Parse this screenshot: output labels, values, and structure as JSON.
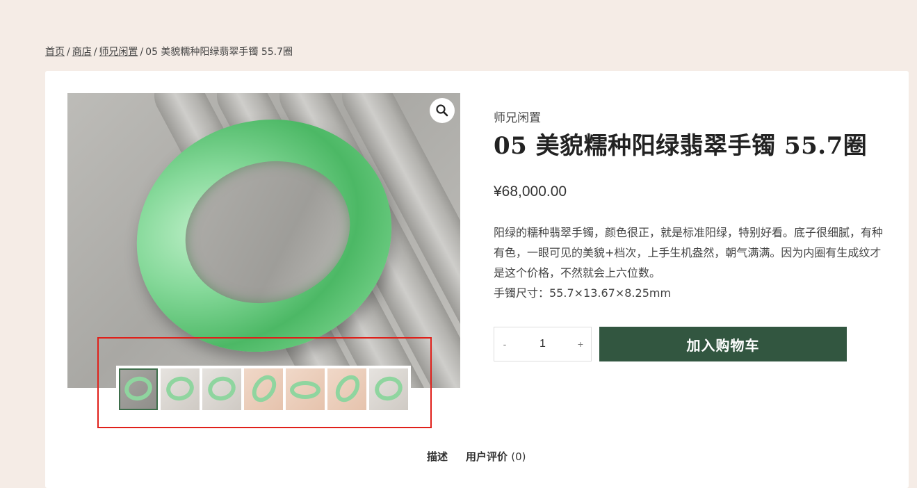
{
  "breadcrumb": {
    "home": "首页",
    "shop": "商店",
    "category": "师兄闲置",
    "separator": "/",
    "current": "05 美貌糯种阳绿翡翠手镯 55.7圈"
  },
  "product": {
    "category": "师兄闲置",
    "title": "05 美貌糯种阳绿翡翠手镯 55.7圈",
    "price": "¥68,000.00",
    "description_lines": [
      "阳绿的糯种翡翠手镯，颜色很正，就是标准阳绿，特别好看。底子很细腻，有种有色，一眼可见的美貌+档次，上手生机盎然，朝气满满。因为内圈有生成纹才是这个价格，不然就会上六位数。",
      "手镯尺寸：55.7×13.67×8.25mm"
    ]
  },
  "gallery": {
    "zoom_icon": "search-icon",
    "thumbnail_count": 7,
    "active_thumbnail": 1
  },
  "cart": {
    "minus_label": "-",
    "quantity": "1",
    "plus_label": "+",
    "add_to_cart_label": "加入购物车"
  },
  "tabs": {
    "description": "描述",
    "reviews_label": "用户评价",
    "reviews_count": "(0)"
  },
  "colors": {
    "page_bg": "#f5ece6",
    "button_bg": "#325640",
    "highlight": "#e0201a"
  }
}
